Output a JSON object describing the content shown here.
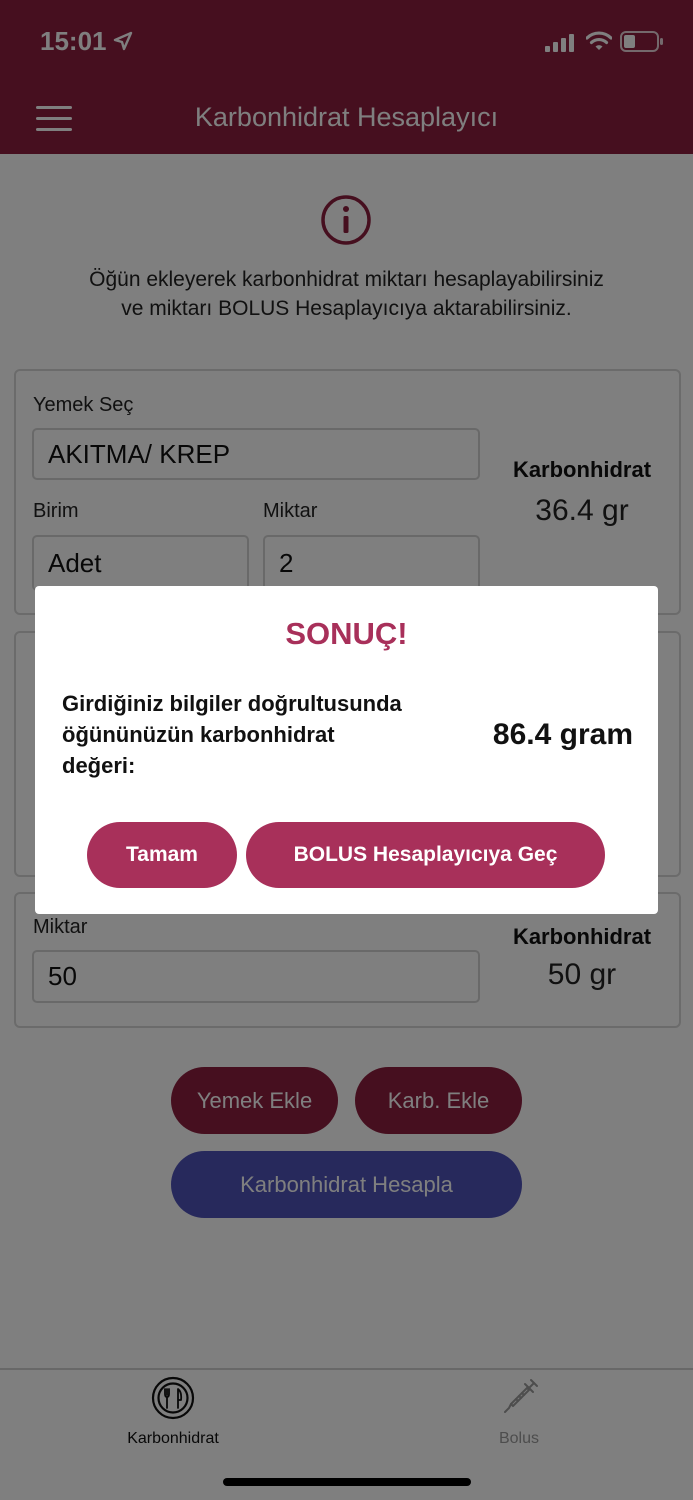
{
  "status_bar": {
    "time": "15:01"
  },
  "header": {
    "title": "Karbonhidrat Hesaplayıcı"
  },
  "info": {
    "line1": "Öğün ekleyerek karbonhidrat miktarı hesaplayabilirsiniz",
    "line2": "ve miktarı BOLUS Hesaplayıcıya aktarabilirsiniz."
  },
  "food_card": {
    "food_label": "Yemek Seç",
    "food_value": "AKITMA/ KREP",
    "unit_label": "Birim",
    "unit_value": "Adet",
    "amount_label": "Miktar",
    "amount_value": "2",
    "carb_label": "Karbonhidrat",
    "carb_value": "36.4 gr"
  },
  "carb_card": {
    "amount_label": "Miktar",
    "amount_value": "50",
    "carb_label": "Karbonhidrat",
    "carb_value": "50 gr"
  },
  "buttons": {
    "add_food": "Yemek Ekle",
    "add_carb": "Karb. Ekle",
    "calculate": "Karbonhidrat Hesapla"
  },
  "tabs": [
    {
      "label": "Karbonhidrat",
      "icon": "plate-fork-knife-icon",
      "active": true
    },
    {
      "label": "Bolus",
      "icon": "syringe-icon",
      "active": false
    }
  ],
  "modal": {
    "title": "SONUÇ!",
    "message_line1": "Girdiğiniz bilgiler doğrultusunda",
    "message_line2": "öğününüzün karbonhidrat",
    "message_line3": "değeri:",
    "value": "86.4 gram",
    "ok_button": "Tamam",
    "bolus_button": "BOLUS Hesaplayıcıya Geç"
  },
  "colors": {
    "header": "#8d1f3f",
    "accent": "#a8305a",
    "primary_button": "#4f53b8"
  }
}
